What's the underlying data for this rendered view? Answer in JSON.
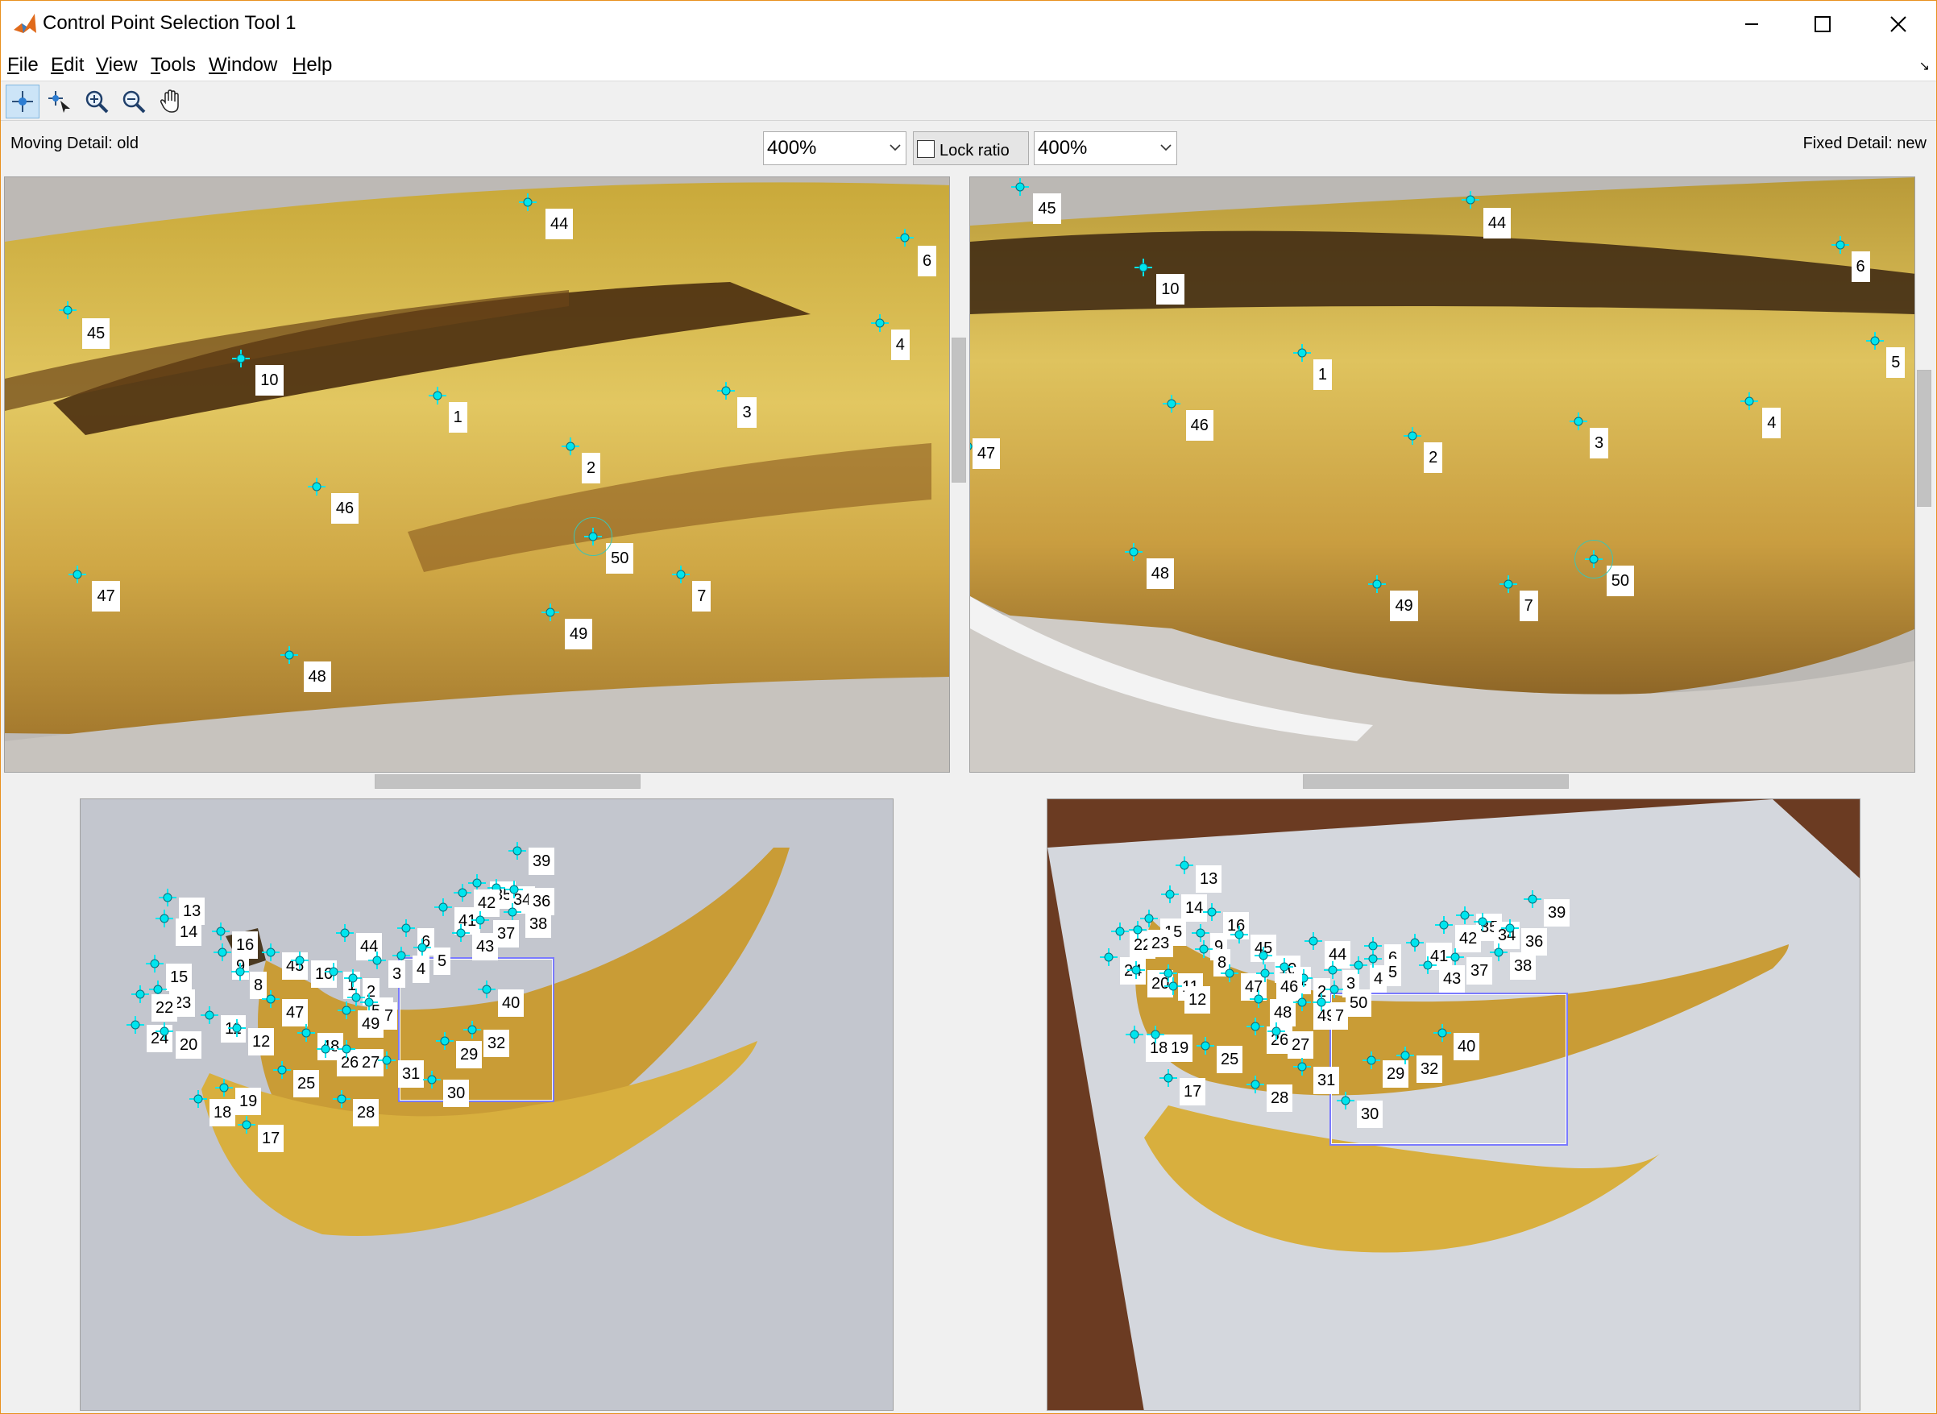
{
  "window": {
    "title": "Control Point Selection Tool 1"
  },
  "menubar": {
    "items": [
      {
        "label": "File",
        "key": "F"
      },
      {
        "label": "Edit",
        "key": "E"
      },
      {
        "label": "View",
        "key": "V"
      },
      {
        "label": "Tools",
        "key": "T"
      },
      {
        "label": "Window",
        "key": "W"
      },
      {
        "label": "Help",
        "key": "H"
      }
    ]
  },
  "toolbar": {
    "tools": [
      "add-point-icon",
      "select-point-icon",
      "zoom-in-icon",
      "zoom-out-icon",
      "pan-hand-icon"
    ],
    "active": "add-point-icon"
  },
  "info": {
    "moving_label": "Moving Detail: old",
    "fixed_label": "Fixed Detail: new",
    "moving_zoom": "400%",
    "fixed_zoom": "400%",
    "lock_ratio": "Lock ratio",
    "lock_checked": false
  },
  "colors": {
    "marker": "#00e5ee",
    "frame": "#e8911f",
    "detail_rect": "#7a7aff"
  },
  "panes": {
    "moving_detail": {
      "points": [
        "44",
        "6",
        "45",
        "10",
        "1",
        "4",
        "3",
        "2",
        "46",
        "50",
        "47",
        "7",
        "49",
        "48"
      ],
      "selected": "50"
    },
    "fixed_detail": {
      "points": [
        "45",
        "44",
        "10",
        "6",
        "1",
        "5",
        "46",
        "4",
        "47",
        "3",
        "2",
        "48",
        "50",
        "49",
        "7"
      ],
      "selected": "50"
    },
    "moving_overview": {
      "points": [
        "39",
        "13",
        "35",
        "34",
        "36",
        "42",
        "14",
        "41",
        "38",
        "37",
        "16",
        "44",
        "6",
        "43",
        "5",
        "9",
        "45",
        "4",
        "10",
        "3",
        "8",
        "15",
        "1",
        "2",
        "23",
        "22",
        "40",
        "50",
        "47",
        "7",
        "49",
        "11",
        "24",
        "20",
        "12",
        "48",
        "26",
        "27",
        "29",
        "32",
        "31",
        "25",
        "30",
        "19",
        "18",
        "28",
        "17"
      ]
    },
    "fixed_overview": {
      "points": [
        "13",
        "39",
        "14",
        "16",
        "35",
        "15",
        "34",
        "36",
        "42",
        "22",
        "23",
        "9",
        "45",
        "44",
        "41",
        "6",
        "8",
        "10",
        "37",
        "24",
        "1",
        "38",
        "20",
        "11",
        "2",
        "3",
        "4",
        "5",
        "43",
        "47",
        "46",
        "12",
        "48",
        "49",
        "7",
        "50",
        "26",
        "27",
        "40",
        "18",
        "19",
        "25",
        "29",
        "32",
        "17",
        "28",
        "31",
        "30"
      ]
    }
  }
}
